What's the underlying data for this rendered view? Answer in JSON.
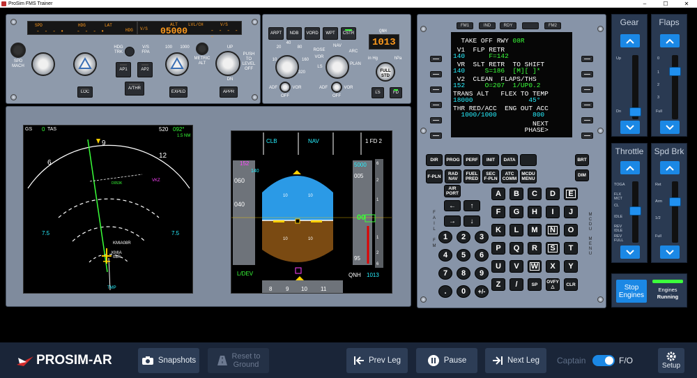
{
  "window": {
    "title": "ProSim FMS Trainer",
    "minimize": "–",
    "maximize": "☐",
    "close": "✕"
  },
  "fcu": {
    "spd_label": "SPD",
    "hdg_label": "HDG",
    "lat_label": "LAT",
    "hdg_right": "HDG",
    "vs_label": "V/S",
    "alt_label": "ALT",
    "lvlch_label": "LVL/CH",
    "vs2_label": "V/S",
    "alt_value": "05000",
    "spd_mach": "SPD\nMACH",
    "hdg_trk": "HDG\nTRK",
    "vs_fpa": "V/S\nFPA",
    "metric_alt": "METRIC\nALT",
    "push_level_off": "PUSH\nTO\nLEVEL\nOFF",
    "up": "UP",
    "dn": "DN",
    "alt_100": "100",
    "alt_1000": "1000",
    "ap1": "AP1",
    "ap2": "AP2",
    "athr": "A/THR",
    "loc": "LOC",
    "exped": "EXPED",
    "appr": "APPR"
  },
  "efis": {
    "arpt": "ARPT",
    "ndb": "NDB",
    "vord": "VORD",
    "wpt": "WPT",
    "cstr": "CSTR",
    "qnh_label": "QNH",
    "qnh_value": "1013",
    "inhg": "in Hg",
    "hpa": "hPa",
    "full_std": "FULL\nSTD",
    "ls": "LS",
    "fd": "FD",
    "range_ticks": [
      "10",
      "20",
      "40",
      "80",
      "160",
      "320"
    ],
    "mode_labels": [
      "ROSE",
      "VOR",
      "NAV",
      "ARC",
      "LS",
      "PLAN"
    ],
    "adf": "ADF",
    "vor": "VOR",
    "off": "OFF"
  },
  "nd": {
    "gs": "GS",
    "gs_val": "0",
    "tas": "TAS",
    "dist": "520",
    "hdg_deg": "092°",
    "nm": "1.5 NM",
    "compass": [
      "6",
      "9",
      "12"
    ],
    "ring_labels": [
      "7.5",
      "7.5"
    ],
    "waypoints": [
      "D053K",
      "VKZ",
      "KMIA",
      "08R",
      "TMP"
    ],
    "ident": "KMIA08R"
  },
  "pfd": {
    "fma": [
      "CLB",
      "NAV",
      "1 FD 2"
    ],
    "speed_tape": [
      "152",
      "140",
      "060",
      "040"
    ],
    "alt_tape": [
      "5000",
      "005",
      "00",
      "95"
    ],
    "qnh": "QNH",
    "qnh_val": "1013",
    "ldev": "L/DEV",
    "heading": [
      "8",
      "9",
      "10",
      "11"
    ],
    "pitch": [
      "10",
      "10",
      "10",
      "10"
    ],
    "vs_scale": [
      "6",
      "2",
      "1",
      "1",
      "2",
      "6"
    ]
  },
  "mcdu": {
    "annunciators": [
      "FM1",
      "IND",
      "RDY",
      "",
      "FM2"
    ],
    "lines": [
      {
        "text": "  TAKE OFF RWY ",
        "color": "w",
        "extra": "08R",
        "extra_color": "g"
      },
      {
        "text": " V1  FLP RETR",
        "color": "w"
      },
      {
        "text": "140",
        "color": "c",
        "mid": "      F=142",
        "mid_color": "g"
      },
      {
        "text": " VR  SLT RETR  TO SHIFT",
        "color": "w"
      },
      {
        "text": "140",
        "color": "c",
        "mid": "     S=186  [M][ ]*",
        "mid_color": "g"
      },
      {
        "text": " V2  CLEAN  FLAPS/THS",
        "color": "w"
      },
      {
        "text": "152",
        "color": "c",
        "mid": "     O=207  1/UP0.2",
        "mid_color": "g"
      },
      {
        "text": "TRANS ALT   FLEX TO TEMP",
        "color": "w"
      },
      {
        "text": "18000",
        "color": "c",
        "mid": "              45°",
        "mid_color": "c"
      },
      {
        "text": "THR RED/ACC  ENG OUT ACC",
        "color": "w"
      },
      {
        "text": "  1000/1000",
        "color": "c",
        "mid": "         800",
        "mid_color": "c"
      },
      {
        "text": "                    NEXT",
        "color": "w"
      },
      {
        "text": "                  PHASE>",
        "color": "w"
      }
    ],
    "func_row1": [
      "DIR",
      "PROG",
      "PERF",
      "INIT",
      "DATA",
      "",
      "BRT"
    ],
    "func_row2": [
      "F-PLN",
      "RAD\nNAV",
      "FUEL\nPRED",
      "SEC\nF-PLN",
      "ATC\nCOMM",
      "MCDU\nMENU",
      "DIM"
    ],
    "airport": "AIR\nPORT",
    "letters": [
      "A",
      "B",
      "C",
      "D",
      "E",
      "F",
      "G",
      "H",
      "I",
      "J",
      "K",
      "L",
      "M",
      "N",
      "O",
      "P",
      "Q",
      "R",
      "S",
      "T",
      "U",
      "V",
      "W",
      "X",
      "Y",
      "Z",
      "/",
      "SP",
      "OVFY\n△",
      "CLR"
    ],
    "numbers": [
      "1",
      "2",
      "3",
      "4",
      "5",
      "6",
      "7",
      "8",
      "9",
      ".",
      "0",
      "+/-"
    ],
    "fail": "FAIL",
    "fm": "FM",
    "mcdu_menu": "MCDU\nMENU"
  },
  "controls": {
    "gear": {
      "title": "Gear",
      "marks": [
        "Up",
        "Dn"
      ],
      "position": 0.95
    },
    "flaps": {
      "title": "Flaps",
      "marks": [
        "0",
        "1",
        "2",
        "3",
        "Full"
      ],
      "position": 0.22
    },
    "throttle": {
      "title": "Throttle",
      "marks": [
        "TOGA",
        "FLX\nMCT",
        "CL",
        "IDLE",
        "REV\nIDLE",
        "REV\nFULL"
      ],
      "position": 0.48
    },
    "speedbrake": {
      "title": "Spd Brk",
      "marks": [
        "Ret",
        "Arm",
        "1/2",
        "Full"
      ],
      "position": 0.3
    },
    "stop_engines": "Stop\nEngines",
    "engines_status_label": "Engines",
    "engines_status": "Running",
    "accent": "#1b88e5",
    "status_green": "#3cff3c"
  },
  "bottom": {
    "logo": "PROSIM-AR",
    "snapshots": "Snapshots",
    "reset": "Reset to\nGround",
    "prev_leg": "Prev Leg",
    "pause": "Pause",
    "next_leg": "Next Leg",
    "captain": "Captain",
    "fo": "F/O",
    "setup": "Setup"
  }
}
